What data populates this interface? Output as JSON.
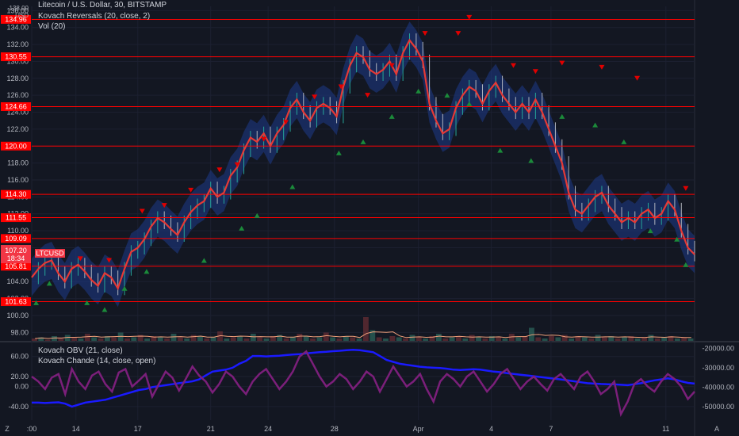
{
  "currency": "USD",
  "legends": {
    "title": "Litecoin / U.S. Dollar, 30, BITSTAMP",
    "indicator": "Kovach Reversals (20, close, 2)",
    "volume": "Vol (20)",
    "obv": "Kovach OBV (21, close)",
    "chande": "Kovach Chande (14, close, open)"
  },
  "price_badge": {
    "symbol": "LTCUSD",
    "price": "107.20",
    "countdown": "18:34",
    "color": "#f23645"
  },
  "corner_buttons": {
    "left": "Z",
    "right": "A"
  },
  "colors": {
    "background": "#131722",
    "level_line": "#ff0000",
    "price_line": "#e53935",
    "band": "#1e3a8a",
    "obv": "#1a1aff",
    "chande": "#7b1f7a",
    "marker_up": "#1b8a3a",
    "marker_down": "#e00000"
  },
  "chart_data": [
    {
      "type": "line",
      "name": "main-price",
      "x_ticks": [
        ":00",
        "14",
        "17",
        "21",
        "24",
        "28",
        "Apr",
        "4",
        "7",
        "11"
      ],
      "y_ticks": [
        "98.00",
        "100.00",
        "102.00",
        "104.00",
        "106.00",
        "108.00",
        "110.00",
        "112.00",
        "114.00",
        "116.00",
        "118.00",
        "120.00",
        "122.00",
        "124.00",
        "126.00",
        "128.00",
        "130.00",
        "132.00",
        "134.00",
        "136.00"
      ],
      "ylim": [
        97,
        136.5
      ],
      "levels": [
        134.96,
        130.55,
        124.66,
        120.0,
        114.3,
        111.55,
        109.09,
        105.81,
        101.63
      ],
      "level_labels": [
        "134.96",
        "130.55",
        "124.66",
        "120.00",
        "114.30",
        "111.55",
        "109.09",
        "105.81",
        "101.63"
      ],
      "x": [
        0,
        3,
        6,
        9,
        12,
        15,
        18,
        21,
        24,
        27,
        30,
        33,
        36,
        39,
        42,
        45,
        48,
        51,
        54,
        57,
        60,
        63,
        66,
        69,
        72,
        75,
        78,
        81,
        84,
        87,
        90,
        93,
        96,
        99,
        102,
        105,
        108,
        111,
        114,
        117,
        120,
        123,
        126,
        129,
        132,
        135,
        138,
        141,
        144,
        147,
        150,
        153,
        156,
        159,
        162,
        165,
        168,
        171,
        174,
        177,
        180,
        183,
        186,
        189,
        192,
        195,
        198,
        201,
        204,
        207,
        210,
        213,
        216,
        219,
        222,
        225,
        228,
        231,
        234,
        237,
        240,
        243,
        246,
        249,
        252,
        255,
        258,
        261,
        264,
        267,
        270,
        273,
        276,
        279,
        282,
        285,
        288,
        291,
        294,
        297,
        300
      ],
      "values": [
        104.5,
        105.5,
        106.2,
        106.5,
        105.0,
        104.0,
        105.5,
        106.0,
        105.2,
        104.2,
        103.5,
        105.0,
        104.5,
        103.2,
        105.5,
        107.5,
        108.0,
        109.0,
        110.5,
        111.5,
        111.0,
        110.2,
        109.5,
        111.0,
        112.2,
        113.0,
        113.5,
        115.0,
        114.0,
        114.5,
        116.5,
        117.5,
        119.5,
        121.0,
        120.5,
        121.5,
        120.0,
        121.5,
        122.5,
        124.5,
        125.5,
        124.0,
        123.0,
        124.5,
        125.0,
        124.5,
        123.5,
        127.0,
        129.5,
        131.0,
        130.5,
        129.0,
        128.5,
        129.0,
        130.0,
        128.5,
        131.0,
        132.5,
        131.5,
        130.0,
        125.0,
        123.0,
        121.5,
        122.0,
        124.5,
        126.0,
        127.0,
        126.5,
        125.0,
        126.5,
        127.5,
        126.0,
        125.0,
        124.0,
        125.0,
        124.0,
        125.5,
        124.0,
        122.0,
        120.0,
        118.0,
        114.5,
        112.5,
        112.0,
        113.0,
        114.0,
        114.5,
        113.0,
        112.0,
        111.0,
        111.5,
        111.0,
        112.0,
        112.5,
        111.5,
        112.0,
        113.5,
        112.5,
        110.0,
        108.0,
        107.2
      ],
      "markers_up": [
        {
          "x": 2,
          "y": 101.5
        },
        {
          "x": 8,
          "y": 103.8
        },
        {
          "x": 25,
          "y": 101.5
        },
        {
          "x": 33,
          "y": 100.7
        },
        {
          "x": 42,
          "y": 103.2
        },
        {
          "x": 52,
          "y": 105.2
        },
        {
          "x": 78,
          "y": 106.5
        },
        {
          "x": 95,
          "y": 110.3
        },
        {
          "x": 102,
          "y": 111.8
        },
        {
          "x": 118,
          "y": 115.2
        },
        {
          "x": 139,
          "y": 119.2
        },
        {
          "x": 150,
          "y": 120.5
        },
        {
          "x": 163,
          "y": 123.5
        },
        {
          "x": 175,
          "y": 126.5
        },
        {
          "x": 188,
          "y": 126.0
        },
        {
          "x": 198,
          "y": 125.0
        },
        {
          "x": 212,
          "y": 119.5
        },
        {
          "x": 226,
          "y": 118.3
        },
        {
          "x": 240,
          "y": 123.5
        },
        {
          "x": 255,
          "y": 122.5
        },
        {
          "x": 268,
          "y": 120.5
        },
        {
          "x": 280,
          "y": 110.0
        },
        {
          "x": 292,
          "y": 109.0
        },
        {
          "x": 296,
          "y": 106.0
        }
      ],
      "markers_down": [
        {
          "x": 22,
          "y": 106.7
        },
        {
          "x": 35,
          "y": 106.5
        },
        {
          "x": 50,
          "y": 112.3
        },
        {
          "x": 60,
          "y": 113.0
        },
        {
          "x": 72,
          "y": 114.8
        },
        {
          "x": 85,
          "y": 117.2
        },
        {
          "x": 93,
          "y": 117.8
        },
        {
          "x": 105,
          "y": 120.8
        },
        {
          "x": 115,
          "y": 122.8
        },
        {
          "x": 128,
          "y": 125.8
        },
        {
          "x": 140,
          "y": 127.0
        },
        {
          "x": 152,
          "y": 126.0
        },
        {
          "x": 163,
          "y": 129.5
        },
        {
          "x": 178,
          "y": 133.3
        },
        {
          "x": 193,
          "y": 133.3
        },
        {
          "x": 198,
          "y": 135.2
        },
        {
          "x": 218,
          "y": 129.5
        },
        {
          "x": 228,
          "y": 128.8
        },
        {
          "x": 240,
          "y": 129.8
        },
        {
          "x": 258,
          "y": 129.3
        },
        {
          "x": 274,
          "y": 128.0
        },
        {
          "x": 296,
          "y": 115.0
        }
      ]
    },
    {
      "type": "area",
      "name": "volume",
      "values": [
        2,
        3,
        1,
        4,
        2,
        5,
        3,
        2,
        6,
        3,
        2,
        4,
        3,
        7,
        2,
        3,
        5,
        2,
        4,
        3,
        2,
        6,
        3,
        2,
        5,
        4,
        2,
        3,
        8,
        2,
        3,
        4,
        2,
        6,
        3,
        2,
        4,
        5,
        2,
        3,
        6,
        4,
        2,
        3,
        7,
        3,
        2,
        4,
        3,
        2,
        20,
        9,
        3,
        2,
        4,
        3,
        2,
        5,
        3,
        2,
        4,
        6,
        2,
        3,
        4,
        2,
        5,
        3,
        2,
        4,
        3,
        2,
        6,
        3,
        4,
        11,
        3,
        2,
        4,
        3,
        5,
        2,
        4,
        3,
        2,
        5,
        3,
        4,
        2,
        3,
        4,
        2,
        3,
        5,
        2,
        3,
        4,
        2,
        3,
        2
      ]
    },
    {
      "type": "line",
      "name": "oscillators",
      "left_ticks": [
        "60.00",
        "20.00",
        "0.00",
        "-40.00"
      ],
      "left_tick_values": [
        60,
        20,
        0,
        -40
      ],
      "right_ticks": [
        "-20000.00",
        "-30000.00",
        "-40000.00",
        "-50000.00"
      ],
      "right_tick_values": [
        -20000,
        -30000,
        -40000,
        -50000
      ],
      "ylim_left": [
        -67,
        88
      ],
      "ylim_right": [
        -57000,
        -17000
      ],
      "series": [
        {
          "name": "Kovach OBV (21, close)",
          "axis": "right",
          "values": [
            -48000,
            -48000,
            -48200,
            -48000,
            -47800,
            -48500,
            -50000,
            -49000,
            -48000,
            -47500,
            -47000,
            -46500,
            -45500,
            -44500,
            -43500,
            -42500,
            -41500,
            -41000,
            -40000,
            -39500,
            -39000,
            -38500,
            -38000,
            -37500,
            -37000,
            -36000,
            -34000,
            -32000,
            -31500,
            -31000,
            -30000,
            -28000,
            -26500,
            -24000,
            -24000,
            -24200,
            -24000,
            -23800,
            -23500,
            -23200,
            -23000,
            -22600,
            -22300,
            -22000,
            -21800,
            -21500,
            -21300,
            -21000,
            -20800,
            -21000,
            -21500,
            -22000,
            -24000,
            -26000,
            -27000,
            -28000,
            -28500,
            -29000,
            -29500,
            -29800,
            -30000,
            -30200,
            -30500,
            -31000,
            -31200,
            -31000,
            -30800,
            -31000,
            -31500,
            -32000,
            -32300,
            -32800,
            -33200,
            -33600,
            -34000,
            -34400,
            -34800,
            -35200,
            -35600,
            -36000,
            -36500,
            -37000,
            -37500,
            -38000,
            -38200,
            -38400,
            -38500,
            -38600,
            -38800,
            -39000,
            -38500,
            -38000,
            -37200,
            -36500,
            -36000,
            -35500,
            -36000,
            -37000,
            -37800,
            -38200
          ]
        },
        {
          "name": "Kovach Chande (14, close, open)",
          "axis": "left",
          "values": [
            20,
            10,
            -5,
            18,
            25,
            -15,
            35,
            10,
            -5,
            22,
            30,
            5,
            -10,
            28,
            35,
            0,
            12,
            25,
            -20,
            5,
            30,
            18,
            -8,
            15,
            40,
            22,
            10,
            -12,
            5,
            30,
            20,
            0,
            -15,
            10,
            25,
            35,
            15,
            -5,
            10,
            30,
            60,
            70,
            45,
            20,
            0,
            10,
            25,
            15,
            -5,
            10,
            30,
            20,
            -10,
            15,
            40,
            20,
            0,
            10,
            25,
            -5,
            -30,
            10,
            25,
            15,
            0,
            20,
            30,
            10,
            -10,
            5,
            25,
            35,
            15,
            -5,
            10,
            20,
            5,
            -8,
            15,
            25,
            10,
            -5,
            20,
            30,
            10,
            -15,
            -5,
            10,
            -55,
            -30,
            5,
            15,
            0,
            -10,
            10,
            25,
            15,
            0,
            -25,
            -10
          ]
        }
      ]
    }
  ],
  "x_axis_labels": [
    ":00",
    "14",
    "17",
    "21",
    "24",
    "28",
    "Apr",
    "4",
    "7",
    "11"
  ],
  "x_axis_label_positions": [
    0,
    20,
    48,
    81,
    107,
    137,
    175,
    208,
    235,
    287
  ]
}
